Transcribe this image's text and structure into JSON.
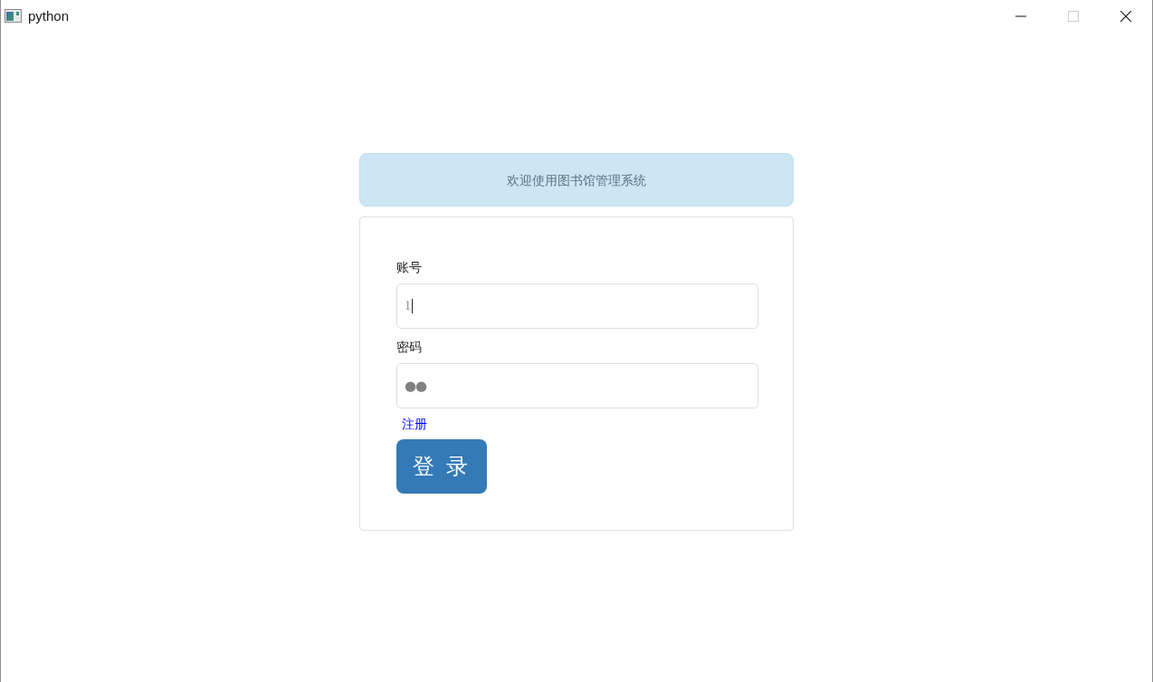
{
  "window": {
    "title": "python",
    "controls": [
      {
        "kind": "minimize",
        "disabled": false
      },
      {
        "kind": "maximize",
        "disabled": true
      },
      {
        "kind": "close",
        "disabled": false
      }
    ]
  },
  "banner": {
    "text": "欢迎使用图书馆管理系统"
  },
  "login_form": {
    "fields": [
      {
        "label": "账号",
        "value": "1",
        "masked": false,
        "focused": true
      },
      {
        "label": "密码",
        "value": "●●",
        "masked": true,
        "focused": false
      }
    ],
    "register_link": "注册",
    "login_button": "登 录"
  }
}
